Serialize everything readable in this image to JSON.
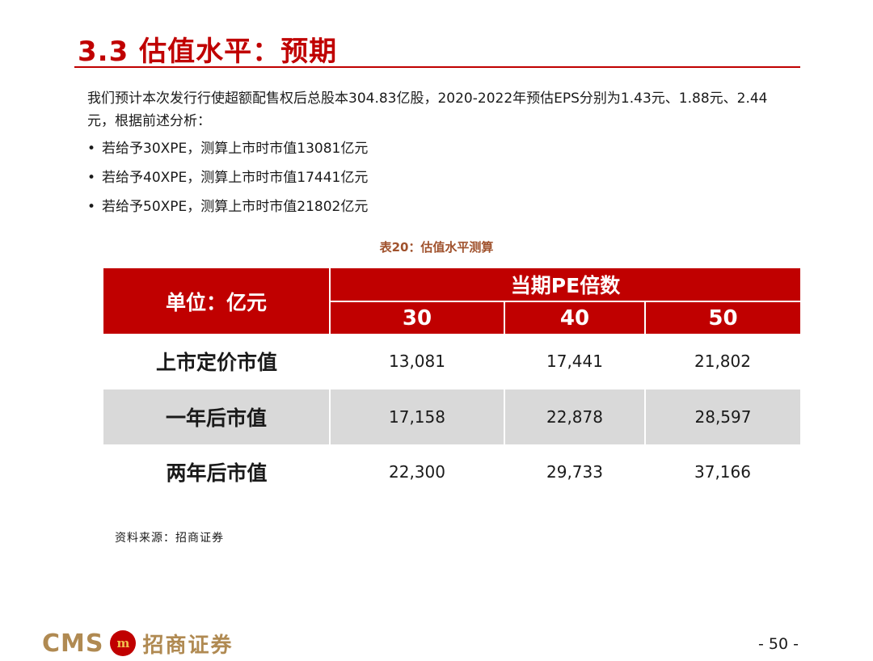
{
  "title": "3.3 估值水平：预期",
  "intro": "我们预计本次发行行使超额配售权后总股本304.83亿股，2020-2022年预估EPS分别为1.43元、1.88元、2.44元，根据前述分析：",
  "bullet_marker": "•",
  "bullets": [
    "若给予30XPE，测算上市时市值13081亿元",
    "若给予40XPE，测算上市时市值17441亿元",
    "若给予50XPE，测算上市时市值21802亿元"
  ],
  "table": {
    "caption": "表20：估值水平测算",
    "unit_header": "单位：亿元",
    "group_header": "当期PE倍数",
    "pe_headers": [
      "30",
      "40",
      "50"
    ],
    "rows": [
      {
        "label": "上市定价市值",
        "values": [
          "13,081",
          "17,441",
          "21,802"
        ]
      },
      {
        "label": "一年后市值",
        "values": [
          "17,158",
          "22,878",
          "28,597"
        ]
      },
      {
        "label": "两年后市值",
        "values": [
          "22,300",
          "29,733",
          "37,166"
        ]
      }
    ]
  },
  "source": "资料来源：招商证券",
  "footer": {
    "logo_text": "CMS",
    "logo_badge": "m",
    "logo_name": "招商证券",
    "page_number": "- 50 -"
  },
  "colors": {
    "accent": "#c00000",
    "shade": "#d9d9d9",
    "logo_gold": "#b08a52"
  }
}
